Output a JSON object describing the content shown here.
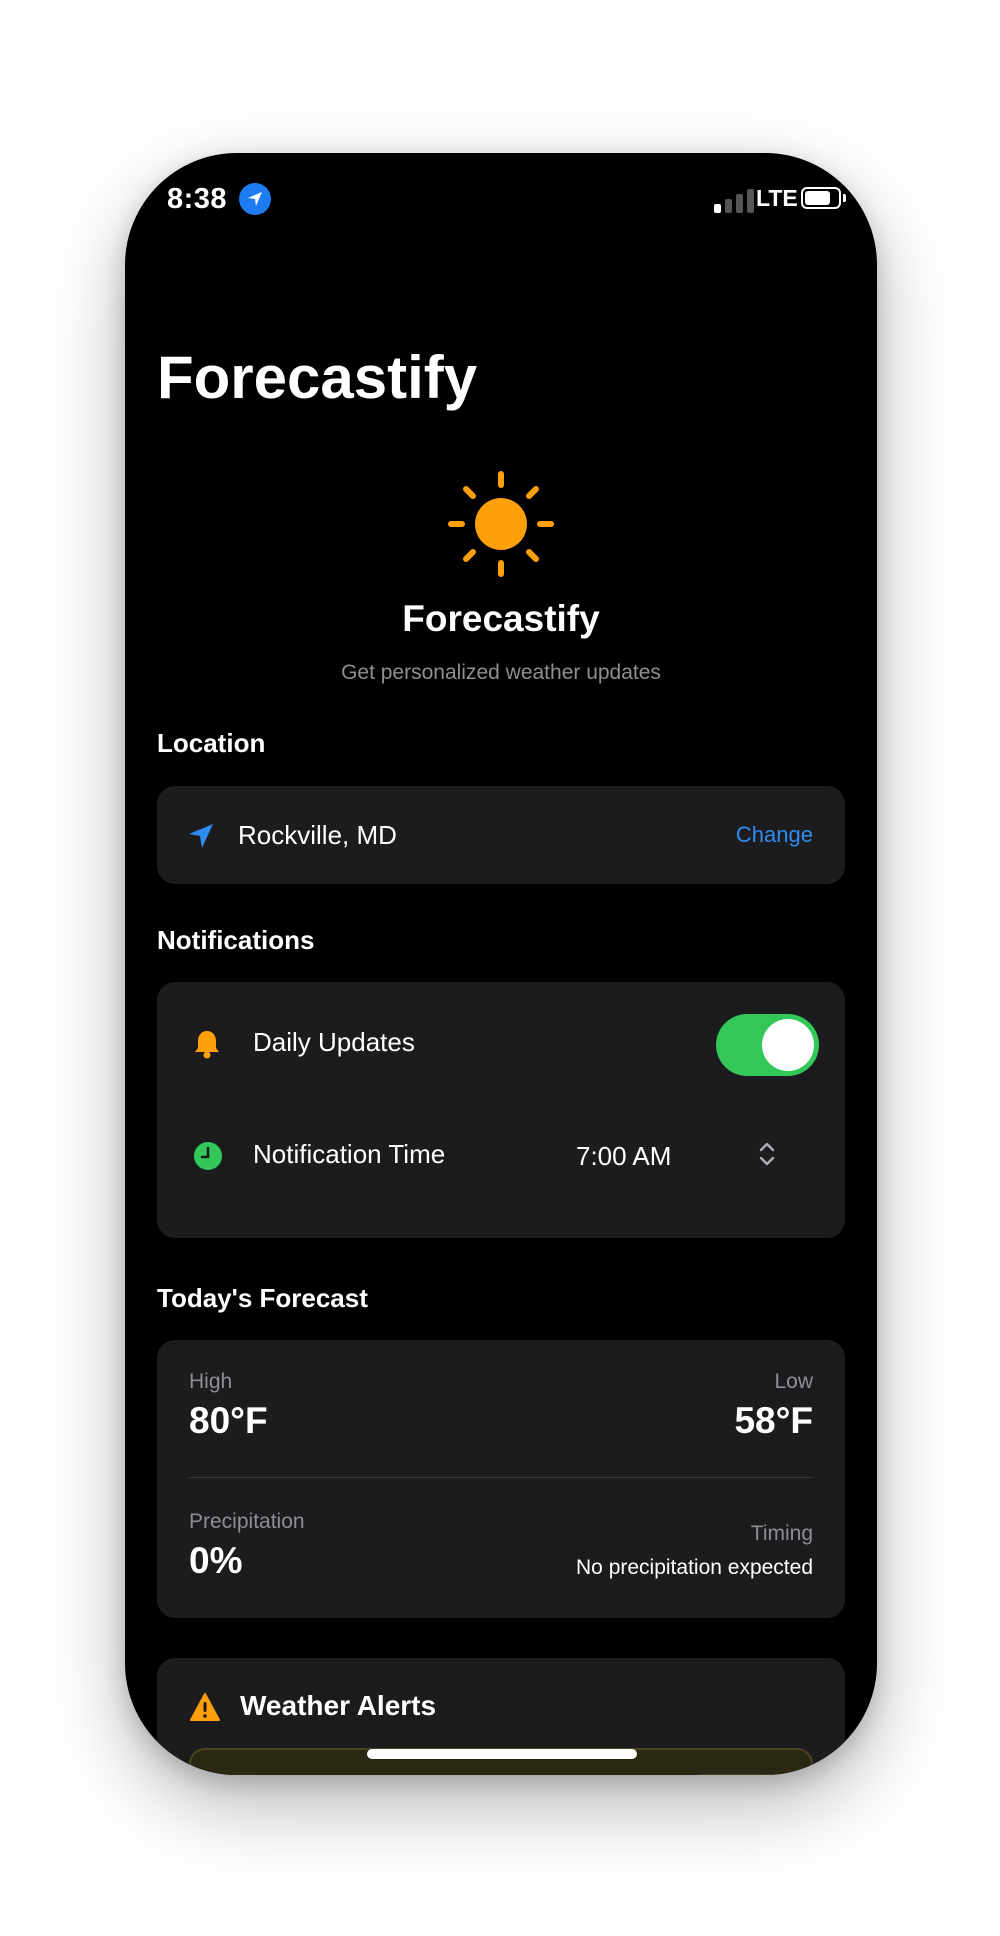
{
  "status_bar": {
    "time": "8:38",
    "network": "LTE"
  },
  "app": {
    "large_title": "Forecastify",
    "name": "Forecastify",
    "tagline": "Get personalized weather updates",
    "sun_color": "#FF9F0A"
  },
  "location": {
    "header": "Location",
    "city": "Rockville, MD",
    "change_label": "Change"
  },
  "notifications": {
    "header": "Notifications",
    "daily_updates_label": "Daily Updates",
    "daily_updates_enabled": true,
    "notification_time_label": "Notification Time",
    "notification_time_value": "7:00 AM"
  },
  "forecast": {
    "header": "Today's Forecast",
    "high_label": "High",
    "high_value": "80°F",
    "low_label": "Low",
    "low_value": "58°F",
    "precip_label": "Precipitation",
    "precip_value": "0%",
    "timing_label": "Timing",
    "timing_value": "No precipitation expected"
  },
  "alerts": {
    "title": "Weather Alerts"
  },
  "colors": {
    "accent_blue": "#2F8CF0",
    "toggle_green": "#34C759",
    "card_bg": "#1C1C1E",
    "warning_orange": "#FF9F0A"
  }
}
